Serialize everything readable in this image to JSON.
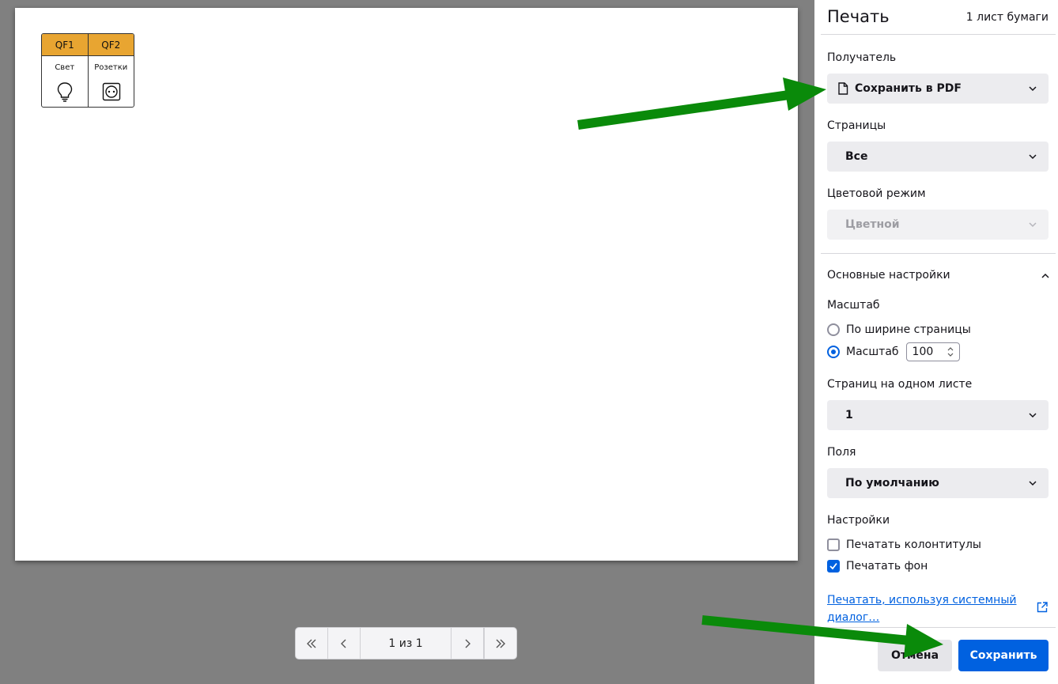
{
  "preview": {
    "breakers": [
      {
        "code": "QF1",
        "label": "Свет",
        "icon": "light-bulb-icon"
      },
      {
        "code": "QF2",
        "label": "Розетки",
        "icon": "socket-icon"
      }
    ],
    "header_color": "#e8a531"
  },
  "navigation": {
    "first_icon": "double-chevron-left-icon",
    "prev_icon": "chevron-left-icon",
    "counter": "1 из 1",
    "next_icon": "chevron-right-icon",
    "last_icon": "double-chevron-right-icon"
  },
  "dialog": {
    "title": "Печать",
    "sheet_count": "1 лист бумаги",
    "destination": {
      "label": "Получатель",
      "value": "Сохранить в PDF",
      "icon": "document-icon"
    },
    "pages": {
      "label": "Страницы",
      "value": "Все"
    },
    "color_mode": {
      "label": "Цветовой режим",
      "value": "Цветной",
      "disabled": true
    },
    "basic_settings": {
      "label": "Основные настройки",
      "expanded": true
    },
    "scale": {
      "label": "Масштаб",
      "fit_width_label": "По ширине страницы",
      "custom_label": "Масштаб",
      "custom_value": "100",
      "selected": "custom"
    },
    "pages_per_sheet": {
      "label": "Страниц на одном листе",
      "value": "1"
    },
    "margins": {
      "label": "Поля",
      "value": "По умолчанию"
    },
    "options": {
      "label": "Настройки",
      "headers_footers": {
        "label": "Печатать колонтитулы",
        "checked": false
      },
      "backgrounds": {
        "label": "Печатать фон",
        "checked": true
      }
    },
    "system_dialog_link": "Печатать, используя системный диалог…",
    "cancel_label": "Отмена",
    "save_label": "Сохранить"
  },
  "colors": {
    "accent": "#0061e0",
    "annotation_arrow": "#0a8a0a"
  }
}
